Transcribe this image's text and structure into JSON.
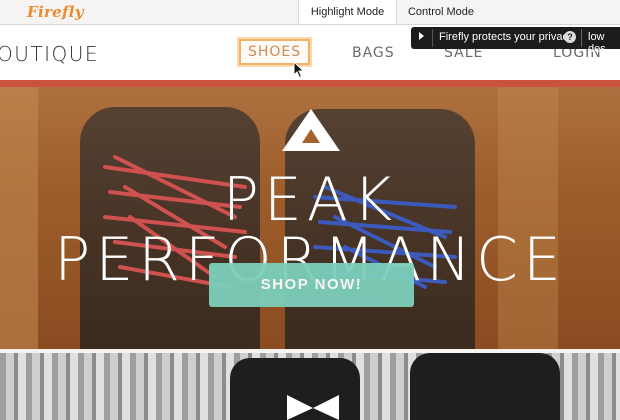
{
  "firefly": {
    "logo": "Firefly",
    "modes": [
      "Highlight Mode",
      "Control Mode"
    ],
    "toast": {
      "message": "Firefly protects your privacy",
      "help": "?",
      "extra": "low des"
    }
  },
  "site": {
    "brand": "OUTIQUE",
    "nav": [
      "SHOES",
      "BAGS",
      "SALE",
      "LOGIN"
    ]
  },
  "hero": {
    "headline": "PEAK PERFORMANCE",
    "cta": "SHOP NOW!"
  },
  "colors": {
    "accent": "#c9533d",
    "cta": "#7ccfbb",
    "highlight": "#f3b166",
    "logo": "#f08a2c"
  }
}
